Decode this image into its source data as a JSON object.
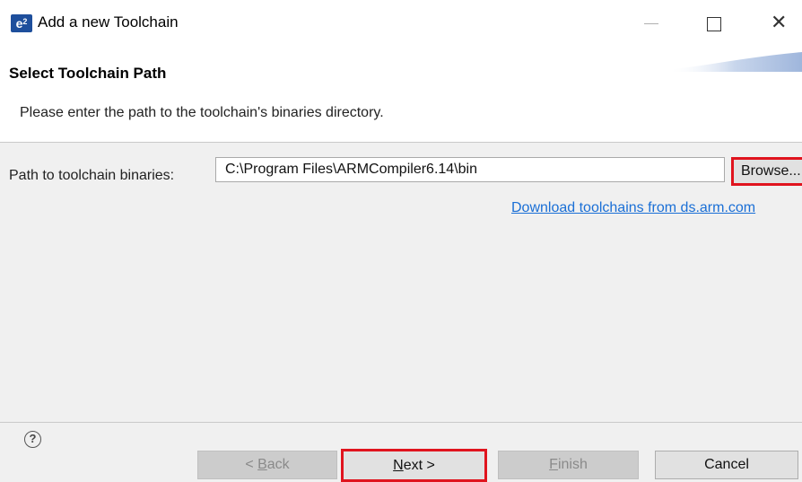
{
  "window": {
    "app_icon_label": "e",
    "app_icon_sup": "2",
    "title": "Add a new Toolchain",
    "minimize_icon": "minimize-icon",
    "maximize_icon": "maximize-icon",
    "close_icon": "close-icon",
    "close_glyph": "✕"
  },
  "header": {
    "title": "Select Toolchain Path",
    "description": "Please enter the path to the toolchain's binaries directory."
  },
  "form": {
    "path_label": "Path to toolchain binaries:",
    "path_value": "C:\\Program Files\\ARMCompiler6.14\\bin",
    "browse_label": "Browse...",
    "download_link": "Download toolchains from ds.arm.com"
  },
  "footer": {
    "help_glyph": "?",
    "back_prefix": "< ",
    "back_mnemonic": "B",
    "back_rest": "ack",
    "next_mnemonic": "N",
    "next_rest": "ext >",
    "finish_mnemonic": "F",
    "finish_rest": "inish",
    "cancel_label": "Cancel",
    "back_enabled": false,
    "finish_enabled": false
  },
  "colors": {
    "highlight": "#e0141e",
    "link": "#1a6fd6",
    "panel_bg": "#f0f0f0"
  }
}
